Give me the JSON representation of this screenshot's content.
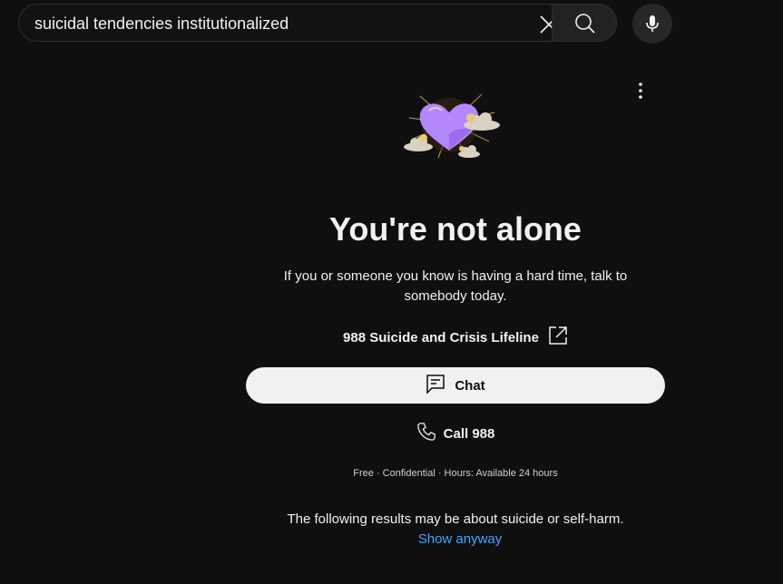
{
  "search": {
    "query": "suicidal tendencies institutionalized",
    "clear_icon": "close-icon",
    "search_icon": "search-icon",
    "mic_icon": "mic-icon"
  },
  "menu": {
    "icon": "more-vertical-icon"
  },
  "crisis_panel": {
    "illustration": "heart-with-clouds-illustration",
    "headline": "You're not alone",
    "subtext": "If you or someone you know is having a hard time, talk to somebody today.",
    "lifeline_label": "988 Suicide and Crisis Lifeline",
    "lifeline_icon": "external-link-icon",
    "chat_label": "Chat",
    "chat_icon": "chat-icon",
    "call_label": "Call 988",
    "call_icon": "phone-icon",
    "details": "Free · Confidential · Hours: Available 24 hours",
    "warning": "The following results may be about suicide or self-harm.",
    "show_anyway_label": "Show anyway"
  },
  "colors": {
    "background": "#0f0f0f",
    "text": "#f1f1f1",
    "link": "#3ea6ff",
    "chat_button_bg": "#f1f1f1",
    "heart": "#b388ff"
  }
}
